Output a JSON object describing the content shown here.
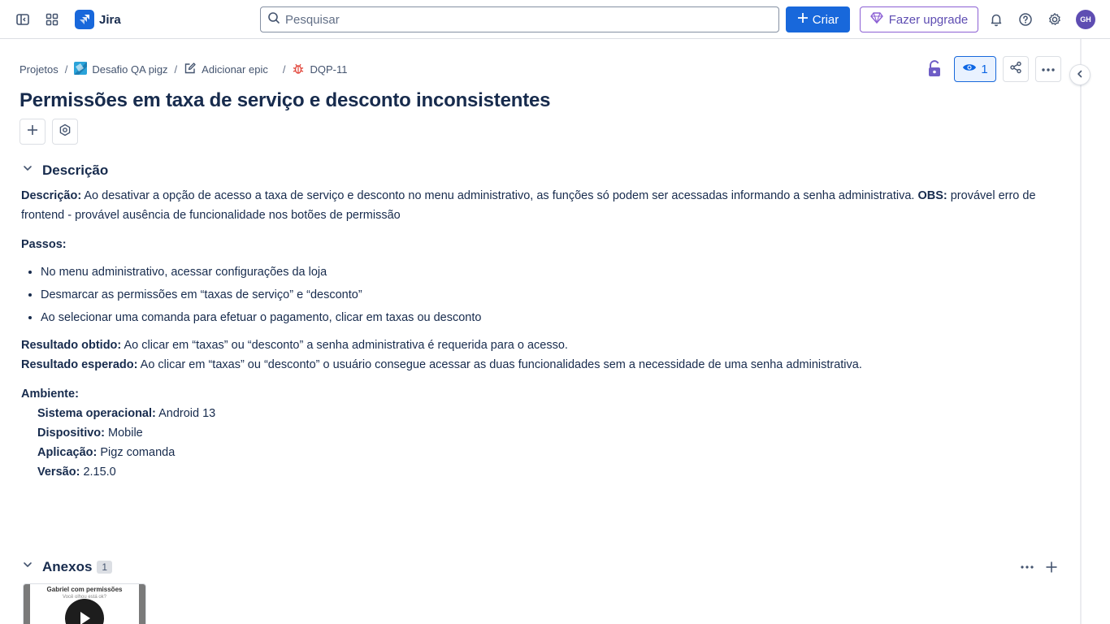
{
  "topbar": {
    "app_name": "Jira",
    "search_placeholder": "Pesquisar",
    "create_label": "Criar",
    "upgrade_label": "Fazer upgrade",
    "avatar_initials": "GH",
    "icons": [
      "sidebar-toggle-icon",
      "app-switcher-icon",
      "jira-logo-icon",
      "search-icon",
      "plus-icon",
      "diamond-icon",
      "bell-icon",
      "help-icon",
      "gear-icon"
    ],
    "colors": {
      "brand": "#1868db",
      "upgrade": "#5e4db2",
      "avatar": "#5e4db2"
    }
  },
  "breadcrumb": {
    "projects": "Projetos",
    "project_name": "Desafio QA pigz",
    "add_epic": "Adicionar epic",
    "issue_key": "DQP-11"
  },
  "header": {
    "watchers_count": "1",
    "icons": [
      "lock-open-icon",
      "eye-icon",
      "share-icon",
      "more-icon",
      "chevron-left-icon"
    ]
  },
  "issue": {
    "title": "Permissões em taxa de serviço e desconto inconsistentes"
  },
  "description": {
    "section_title": "Descrição",
    "intro_label": "Descrição:",
    "intro_text": "Ao desativar a opção de acesso a taxa de serviço e desconto no menu administrativo, as funções só podem ser acessadas informando a senha administrativa.",
    "obs_label": "OBS:",
    "obs_text": "provável erro de frontend - provável ausência de funcionalidade nos botões de permissão",
    "steps_label": "Passos:",
    "steps": [
      "No menu administrativo, acessar configurações da loja",
      "Desmarcar as permissões em “taxas de serviço” e “desconto”",
      "Ao selecionar uma comanda para efetuar o pagamento, clicar em taxas ou desconto"
    ],
    "obtained_label": "Resultado obtido:",
    "obtained_text": "Ao clicar em “taxas” ou “desconto” a senha administrativa é requerida para o acesso.",
    "expected_label": "Resultado esperado:",
    "expected_text": "Ao clicar em “taxas” ou “desconto” o usuário consegue acessar as duas funcionalidades sem a necessidade de uma senha administrativa.",
    "env_label": "Ambiente:",
    "env": [
      {
        "label": "Sistema operacional:",
        "value": "Android 13"
      },
      {
        "label": "Dispositivo:",
        "value": "Mobile"
      },
      {
        "label": "Aplicação:",
        "value": "Pigz comanda"
      },
      {
        "label": "Versão:",
        "value": "2.15.0"
      }
    ]
  },
  "attachments": {
    "section_title": "Anexos",
    "count": "1",
    "thumb_title": "Gabriel com permissões",
    "thumb_sub": "Você olhou está ok?"
  }
}
